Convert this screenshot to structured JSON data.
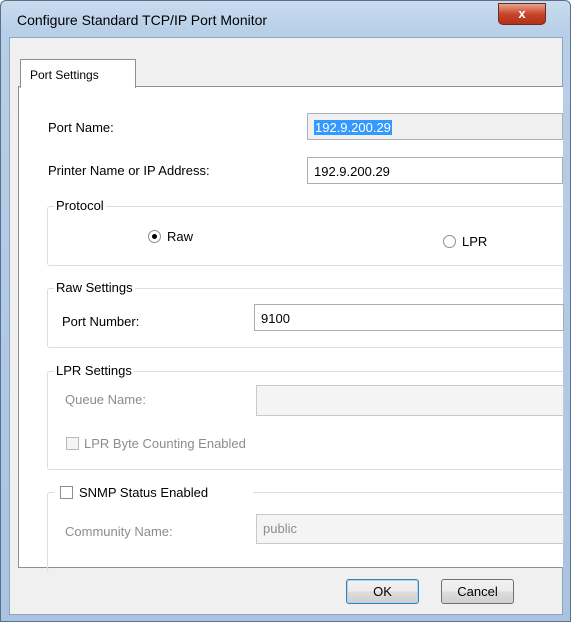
{
  "window": {
    "title": "Configure Standard TCP/IP Port Monitor",
    "close_glyph": "x"
  },
  "tabs": [
    {
      "label": "Port Settings",
      "selected": true
    }
  ],
  "port_settings": {
    "port_name": {
      "label": "Port Name:",
      "value": "192.9.200.29",
      "selected": true,
      "read_only": true
    },
    "printer_name": {
      "label": "Printer Name or IP Address:",
      "value": "192.9.200.29"
    },
    "protocol": {
      "legend": "Protocol",
      "options": [
        {
          "label": "Raw",
          "selected": true
        },
        {
          "label": "LPR",
          "selected": false
        }
      ]
    },
    "raw_settings": {
      "legend": "Raw Settings",
      "port_number": {
        "label": "Port Number:",
        "value": "9100"
      }
    },
    "lpr_settings": {
      "legend": "LPR Settings",
      "queue_name": {
        "label": "Queue Name:",
        "value": "",
        "disabled": true
      },
      "byte_counting": {
        "label": "LPR Byte Counting Enabled",
        "checked": false,
        "disabled": true
      }
    },
    "snmp": {
      "label": "SNMP Status Enabled",
      "checked": false,
      "community_name": {
        "label": "Community Name:",
        "value": "public",
        "disabled": true
      }
    }
  },
  "buttons": {
    "ok": "OK",
    "cancel": "Cancel"
  }
}
